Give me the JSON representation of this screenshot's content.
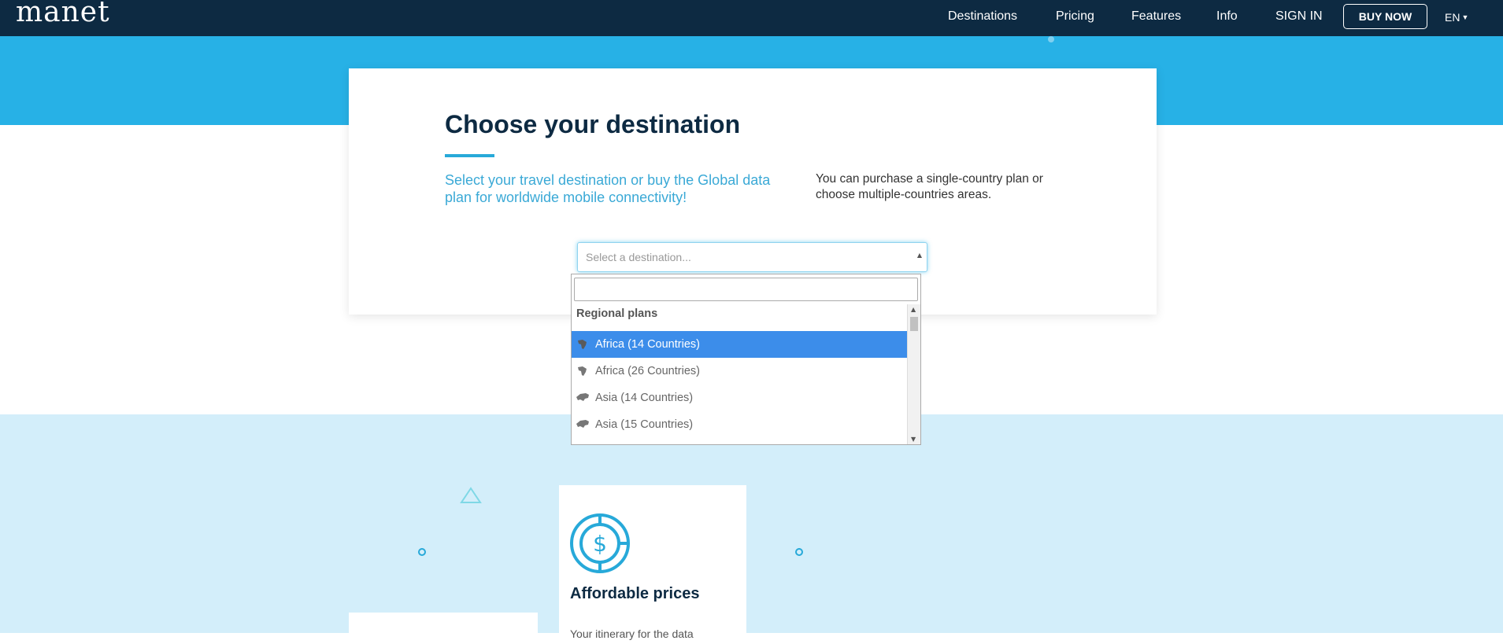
{
  "nav": {
    "logo": "manet",
    "links": [
      "Destinations",
      "Pricing",
      "Features",
      "Info",
      "SIGN IN"
    ],
    "buy_label": "BUY NOW",
    "lang": "EN"
  },
  "hero": {
    "title": "Choose your destination",
    "lead": "Select your travel destination or buy the Global data plan for worldwide mobile connectivity!",
    "note": "You can purchase a single-country plan or choose multiple-countries areas."
  },
  "select": {
    "placeholder": "Select a destination...",
    "search_value": "",
    "group_label": "Regional plans",
    "options": [
      {
        "label": "Africa (14 Countries)",
        "icon": "africa-icon",
        "active": true
      },
      {
        "label": "Africa (26 Countries)",
        "icon": "africa-icon",
        "active": false
      },
      {
        "label": "Asia (14 Countries)",
        "icon": "asia-icon",
        "active": false
      },
      {
        "label": "Asia (15 Countries)",
        "icon": "asia-icon",
        "active": false
      }
    ]
  },
  "features": [
    {
      "title": "Affordable prices",
      "icon": "dollar-coin-icon",
      "text": "Your itinerary for the data"
    }
  ],
  "colors": {
    "navbar": "#0d2a42",
    "hero_band": "#27b1e6",
    "lower_band": "#d3eefa",
    "accent": "#27a9d9",
    "option_active": "#3c8dea"
  }
}
